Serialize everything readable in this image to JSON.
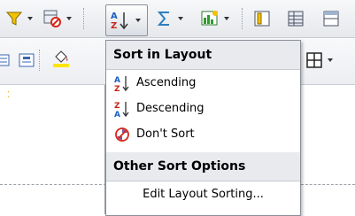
{
  "toolbar": {
    "row1_buttons": [
      {
        "icon": "filter-icon"
      },
      {
        "icon": "no-filter-icon"
      },
      {
        "icon": "sort-az-icon",
        "pressed": true
      },
      {
        "icon": "sum-icon"
      },
      {
        "icon": "insert-chart-icon"
      },
      {
        "icon": "column-view-icon"
      },
      {
        "icon": "table-view-icon"
      },
      {
        "icon": "form-view-icon"
      }
    ],
    "row2_buttons": [
      {
        "icon": "align-left-icon"
      },
      {
        "icon": "align-center-icon"
      },
      {
        "icon": "fill-color-icon"
      },
      {
        "icon": "grid-icon"
      }
    ],
    "fill_accent": "#ffe400"
  },
  "menu": {
    "sections": [
      {
        "title": "Sort in Layout",
        "items": [
          {
            "label": "Ascending",
            "icon": "sort-ascending-icon"
          },
          {
            "label": "Descending",
            "icon": "sort-descending-icon"
          },
          {
            "label": "Don't Sort",
            "icon": "no-sort-icon"
          }
        ]
      },
      {
        "title": "Other Sort Options",
        "items": [
          {
            "label": "Edit Layout Sorting...",
            "icon": ""
          }
        ]
      }
    ]
  }
}
